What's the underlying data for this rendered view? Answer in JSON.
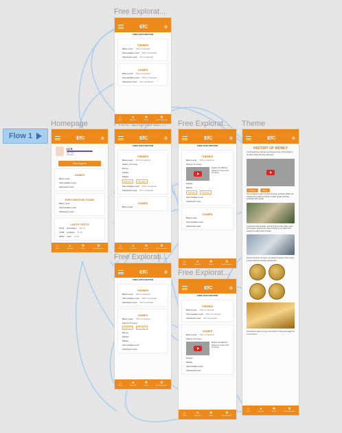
{
  "flow": {
    "label": "Flow 1"
  },
  "labels": {
    "free_top": "Free Explorat...",
    "homepage": "Homepage",
    "free_mid": "Free Explorat...",
    "free_right": "Free Explorat...",
    "theme": "Theme",
    "free_low": "Free Explorati...",
    "free_bottom": "Free Explorat..."
  },
  "app": {
    "logo": "EfC",
    "nav": [
      "Home",
      "My profile",
      "Games",
      "My achievements"
    ]
  },
  "home": {
    "level": "LV 5",
    "xp": "500 / 700",
    "name": "John Doe",
    "free_explore_btn": "Free Explore",
    "games_title": "GAMES",
    "levels": [
      "Basic Level",
      "Intermediate Level",
      "Advanced Level"
    ],
    "guide_title": "EXPLORATION GUIDE",
    "tests_title": "LASTS TESTS",
    "tests": [
      {
        "date": "10/11",
        "name": "Revolution",
        "score": "10/ 10"
      },
      {
        "date": "11/08",
        "name": "Ambition",
        "score": "8/ 10"
      },
      {
        "date": "09/02",
        "name": "Hero",
        "score": "6/ 10"
      }
    ]
  },
  "free": {
    "title": "FREE EXPLORATION",
    "themes_title": "THEMES",
    "games_title": "GAMES",
    "basic": "Basic Level",
    "intermediate": "Intermediate Level",
    "advanced": "Advanced Level",
    "completed_basic": "70% Completed",
    "completed_int": "40% Completed",
    "completed_adv": "0% Completed",
    "items": [
      "History of money",
      "Money",
      "Politics",
      "Market"
    ],
    "explore": "Explore",
    "preview": "Preview",
    "video_caption": "Explore the different phases of money and its history."
  },
  "theme": {
    "title": "HISTORY OF MONEY",
    "intro": "In the beginning, humans exchanged some of the things to do other things that they will need.",
    "btn_a": "Practice",
    "btn_b": "Study",
    "p1": "The exchange system is what is known as barter. Barter the simplest and easiest of forms to trade people and they exchange their goods.",
    "p2": "It was then that societies, and all of them knew what, mass and number, defined the value of things to an object that would be a valid mode of trade.",
    "p3": "Another asset by its name, we started to become the money to keep that the monetary requirement.",
    "p4": "How did the paper money come about? That is the subject of a new lesson."
  }
}
